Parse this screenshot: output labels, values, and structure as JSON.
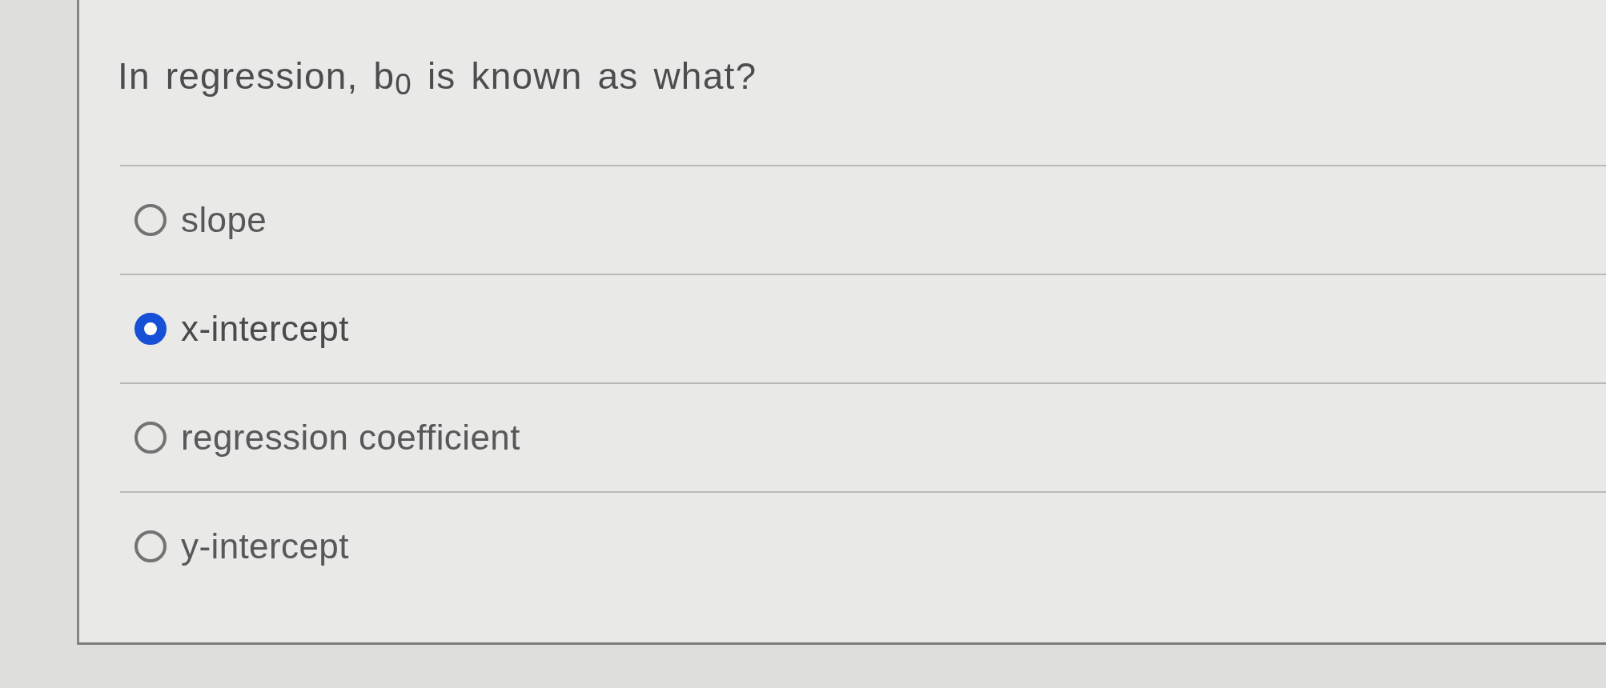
{
  "question": {
    "text": "In regression, b$_{0}$ is known as what?"
  },
  "options": [
    {
      "label": "slope",
      "selected": false
    },
    {
      "label": "x-intercept",
      "selected": true
    },
    {
      "label": "regression coefficient",
      "selected": false
    },
    {
      "label": "y-intercept",
      "selected": false
    }
  ]
}
